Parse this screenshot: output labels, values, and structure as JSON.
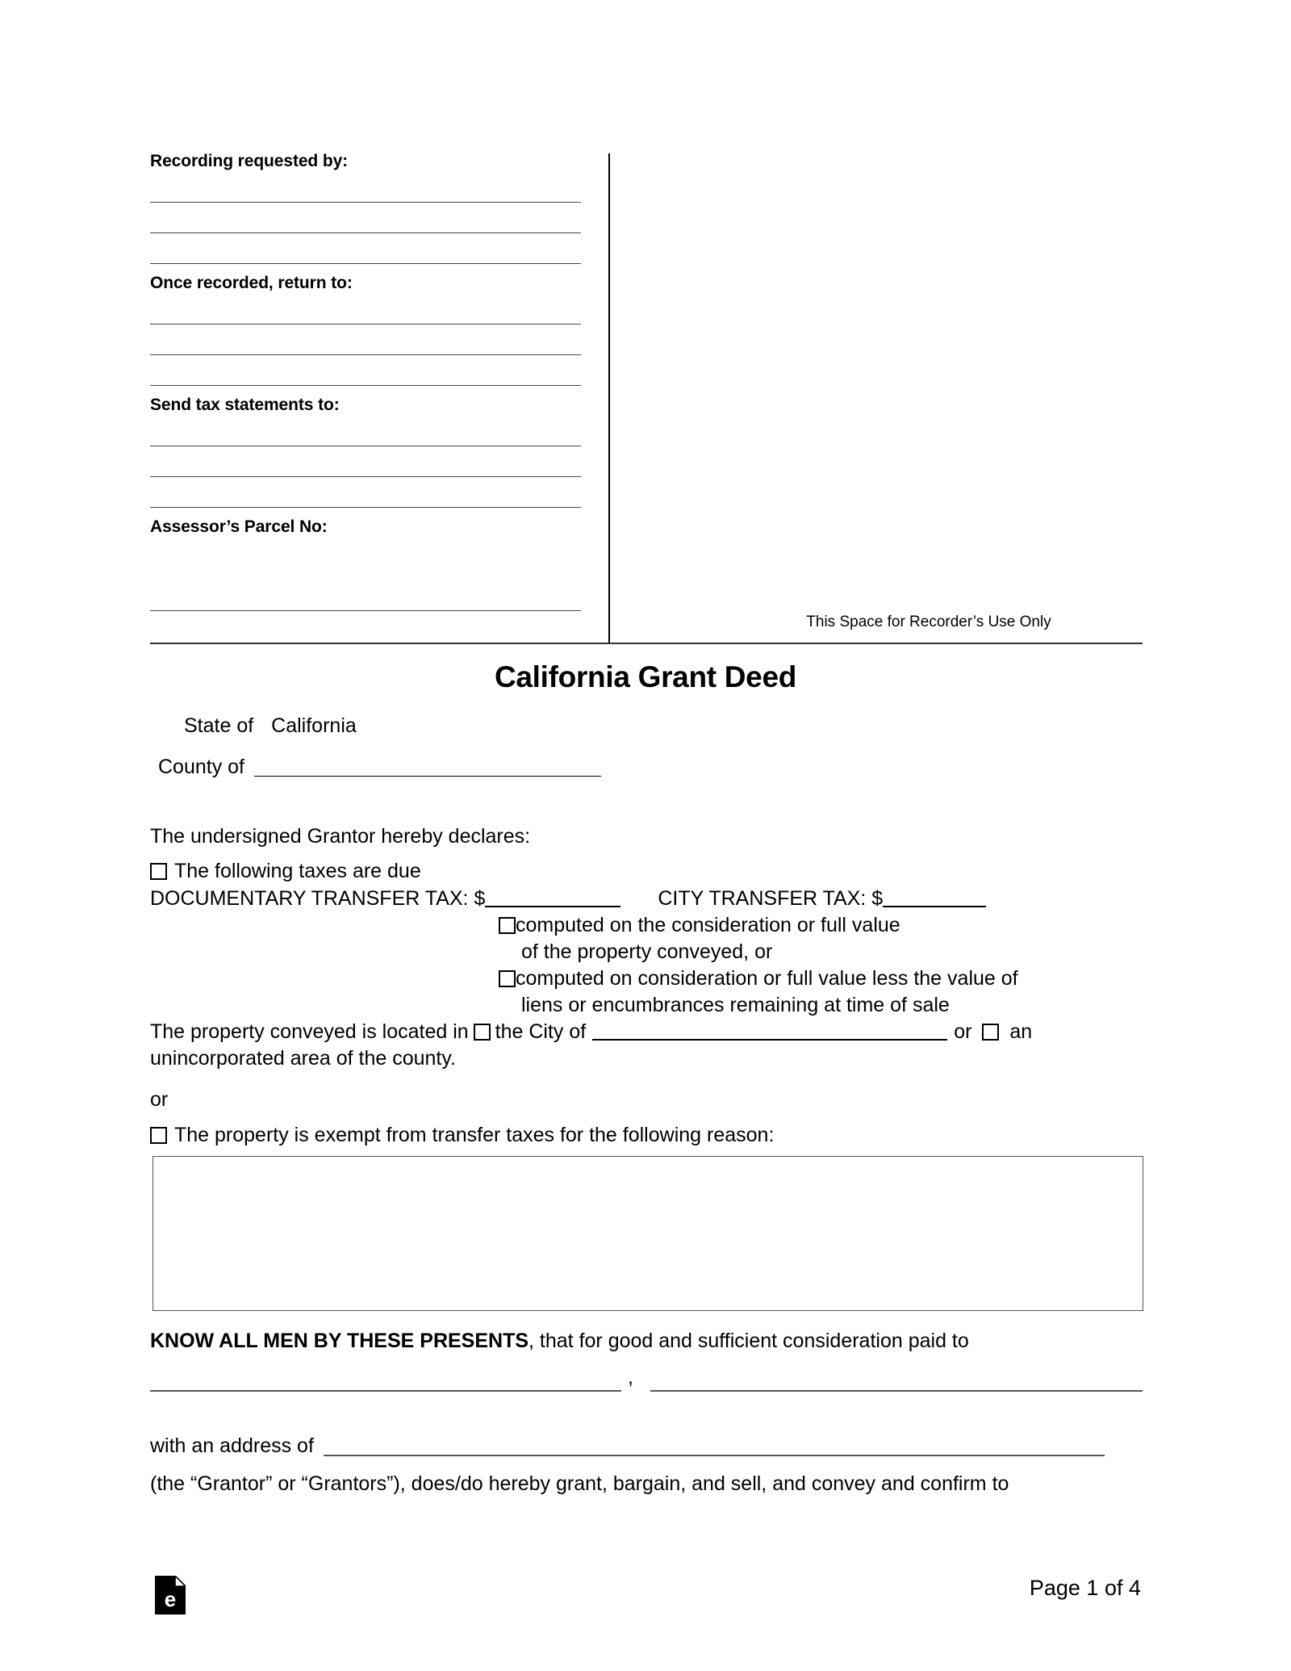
{
  "document": {
    "title": "California Grant Deed",
    "page_label": "Page 1 of 4"
  },
  "recording_block": {
    "recording_requested_by_label": "Recording requested by:",
    "once_recorded_return_to_label": "Once recorded, return to:",
    "send_tax_statements_to_label": "Send tax statements to:",
    "assessors_parcel_no_label": "Assessor’s Parcel No:",
    "recorder_use_note": "This Space for Recorder’s Use Only"
  },
  "jurisdiction": {
    "state_label": "State of",
    "state_value": "California",
    "county_label": "County of",
    "county_value": ""
  },
  "declarations": {
    "intro": "The undersigned Grantor hereby declares:",
    "taxes_due_label": "The following taxes are due",
    "documentary_transfer_tax_label": "DOCUMENTARY TRANSFER TAX: $",
    "documentary_transfer_tax_value": "",
    "city_transfer_tax_label": "CITY TRANSFER TAX: $",
    "city_transfer_tax_value": "",
    "option_one_line_one": "computed on the consideration or full value",
    "option_one_line_two": "of the property conveyed, or",
    "option_two_line_one": "computed on consideration or full value less the value of",
    "option_two_line_two": "liens or encumbrances remaining at time of sale",
    "located_prefix": "The property conveyed is located in",
    "located_city_label": "the City of",
    "located_city_value": "",
    "located_or": "or",
    "located_suffix": "an",
    "located_line_two": "unincorporated area of the county.",
    "or_separator": "or",
    "exempt_label": "The property is exempt from transfer taxes for the following reason:",
    "exempt_reason_value": ""
  },
  "granting_clause": {
    "know_all_men_bold": "KNOW ALL MEN BY THESE PRESENTS",
    "know_all_men_rest": ", that for good and sufficient consideration paid to",
    "grantor_name_one": "",
    "grantor_comma": ",",
    "grantor_name_two": "",
    "address_label": "with an address of",
    "address_value": "",
    "grantor_definition": "(the “Grantor” or “Grantors”), does/do hereby grant, bargain, and sell, and convey and confirm to"
  },
  "icons": {
    "logo": "eforms-document-logo",
    "checkbox": "empty-checkbox-icon"
  }
}
